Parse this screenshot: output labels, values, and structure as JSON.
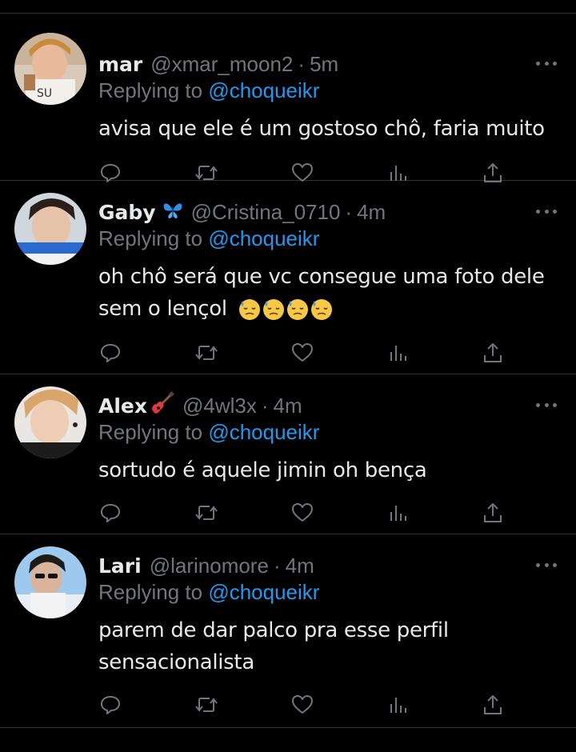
{
  "colors": {
    "background": "#000000",
    "text": "#e7e9ea",
    "muted": "#71767b",
    "mention": "#1d9bf0",
    "divider": "#2f3336"
  },
  "tweets": [
    {
      "name": "mar",
      "handle": "@xmar_moon2",
      "separator": "·",
      "time": "5m",
      "replying_prefix": "Replying to",
      "replying_to": "@choqueikr",
      "text_lines": [
        "avisa que ele é um gostoso chô, faria muito"
      ],
      "avatar_icon": "avatar-photo"
    },
    {
      "name": "Gaby",
      "name_emoji": "butterfly-icon",
      "handle": "@Cristina_0710",
      "separator": "·",
      "time": "4m",
      "replying_prefix": "Replying to",
      "replying_to": "@choqueikr",
      "text_lines": [
        "oh chô será que vc consegue uma foto dele",
        "sem o lençol"
      ],
      "trailing_emojis": [
        "downcast-sweat-face-icon",
        "downcast-sweat-face-icon",
        "downcast-sweat-face-icon",
        "downcast-sweat-face-icon"
      ],
      "avatar_icon": "avatar-photo"
    },
    {
      "name": "Alex",
      "name_emoji": "guitar-icon",
      "handle": "@4wl3x",
      "separator": "·",
      "time": "4m",
      "replying_prefix": "Replying to",
      "replying_to": "@choqueikr",
      "text_lines": [
        "sortudo é aquele jimin oh bença"
      ],
      "avatar_icon": "avatar-photo"
    },
    {
      "name": "Lari",
      "handle": "@larinomore",
      "separator": "·",
      "time": "4m",
      "replying_prefix": "Replying to",
      "replying_to": "@choqueikr",
      "text_lines": [
        "parem de dar palco pra esse perfil",
        "sensacionalista"
      ],
      "avatar_icon": "avatar-photo"
    }
  ],
  "action_icons": [
    "reply-icon",
    "retweet-icon",
    "like-icon",
    "views-icon",
    "share-icon"
  ]
}
